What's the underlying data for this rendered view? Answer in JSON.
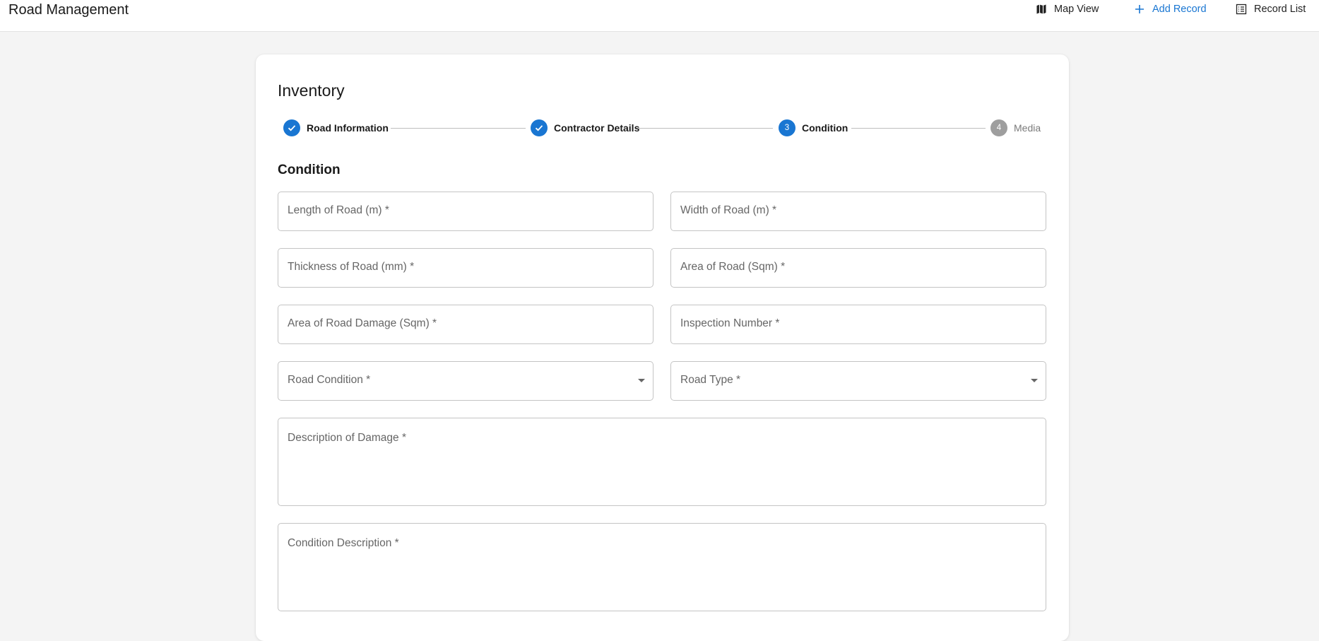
{
  "app": {
    "title": "Road Management"
  },
  "nav": {
    "map_view": "Map View",
    "add_record": "Add Record",
    "record_list": "Record List"
  },
  "form": {
    "title": "Inventory",
    "section_title": "Condition",
    "steps": [
      {
        "label": "Road Information",
        "state": "done",
        "number": "1"
      },
      {
        "label": "Contractor Details",
        "state": "done",
        "number": "2"
      },
      {
        "label": "Condition",
        "state": "active",
        "number": "3"
      },
      {
        "label": "Media",
        "state": "pending",
        "number": "4"
      }
    ],
    "fields": {
      "length": {
        "label": "Length of Road (m) *",
        "value": ""
      },
      "width": {
        "label": "Width of Road (m) *",
        "value": ""
      },
      "thickness": {
        "label": "Thickness of Road (mm) *",
        "value": ""
      },
      "area": {
        "label": "Area of Road (Sqm) *",
        "value": ""
      },
      "area_damage": {
        "label": "Area of Road Damage (Sqm) *",
        "value": ""
      },
      "inspection_number": {
        "label": "Inspection Number *",
        "value": ""
      },
      "road_condition": {
        "label": "Road Condition *",
        "value": ""
      },
      "road_type": {
        "label": "Road Type *",
        "value": ""
      },
      "description_damage": {
        "label": "Description of Damage *",
        "value": ""
      },
      "condition_description": {
        "label": "Condition Description *",
        "value": ""
      }
    }
  },
  "colors": {
    "primary": "#1976d2",
    "pending": "#9e9e9e",
    "background": "#f4f4f4",
    "border": "#c4c4c4"
  }
}
